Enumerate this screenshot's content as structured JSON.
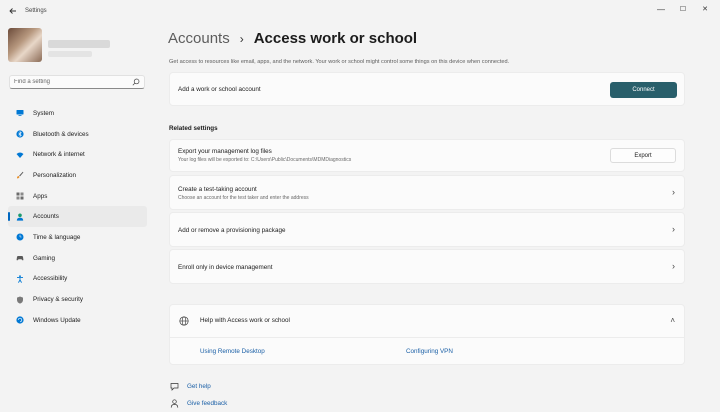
{
  "window": {
    "title": "Settings",
    "minimize": "—",
    "maximize": "☐",
    "close": "✕"
  },
  "search": {
    "placeholder": "Find a setting"
  },
  "sidebar": {
    "items": [
      {
        "label": "System",
        "icon": "monitor-icon",
        "color": "#0078d4"
      },
      {
        "label": "Bluetooth & devices",
        "icon": "bluetooth-icon",
        "color": "#0078d4"
      },
      {
        "label": "Network & internet",
        "icon": "wifi-icon",
        "color": "#0078d4"
      },
      {
        "label": "Personalization",
        "icon": "brush-icon",
        "color": "#e8912e"
      },
      {
        "label": "Apps",
        "icon": "apps-icon",
        "color": "#5a5a5a"
      },
      {
        "label": "Accounts",
        "icon": "person-icon",
        "color": "#1c9a6f",
        "active": true
      },
      {
        "label": "Time & language",
        "icon": "globe-clock-icon",
        "color": "#0078d4"
      },
      {
        "label": "Gaming",
        "icon": "gamepad-icon",
        "color": "#5a5a5a"
      },
      {
        "label": "Accessibility",
        "icon": "accessibility-icon",
        "color": "#0078d4"
      },
      {
        "label": "Privacy & security",
        "icon": "shield-icon",
        "color": "#6b6b6b"
      },
      {
        "label": "Windows Update",
        "icon": "update-icon",
        "color": "#0078d4"
      }
    ]
  },
  "header": {
    "parent": "Accounts",
    "separator": "›",
    "current": "Access work or school"
  },
  "description": "Get access to resources like email, apps, and the network. Your work or school might control some things on this device when connected.",
  "add_account": {
    "label": "Add a work or school account",
    "button": "Connect"
  },
  "related": {
    "heading": "Related settings",
    "export": {
      "title": "Export your management log files",
      "subtitle": "Your log files will be exported to: C:\\Users\\Public\\Documents\\MDMDiagnostics",
      "button": "Export"
    },
    "test_account": {
      "title": "Create a test-taking account",
      "subtitle": "Choose an account for the test taker and enter the address",
      "chevron": "›"
    },
    "provisioning": {
      "title": "Add or remove a provisioning package",
      "chevron": "›"
    },
    "enroll": {
      "title": "Enroll only in device management",
      "chevron": "›"
    }
  },
  "help": {
    "title": "Help with Access work or school",
    "chevron": "˄",
    "links": [
      "Using Remote Desktop",
      "Configuring VPN"
    ]
  },
  "footer": {
    "get_help": "Get help",
    "give_feedback": "Give feedback"
  },
  "colors": {
    "accent": "#0067c0",
    "connect_button": "#295f6b",
    "link": "#1a5fa6"
  }
}
